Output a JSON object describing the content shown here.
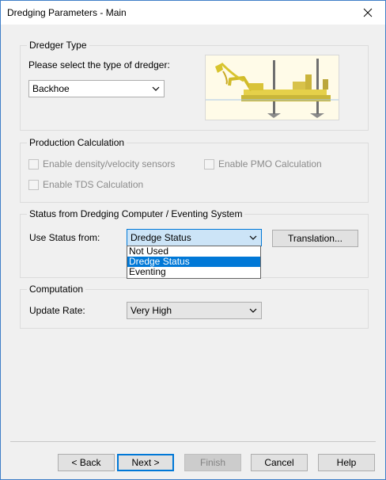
{
  "window": {
    "title": "Dredging Parameters - Main"
  },
  "dredger_type": {
    "group_label": "Dredger Type",
    "prompt": "Please select the type of dredger:",
    "selected": "Backhoe"
  },
  "production": {
    "group_label": "Production Calculation",
    "density_label": "Enable density/velocity sensors",
    "pmo_label": "Enable PMO Calculation",
    "tds_label": "Enable TDS Calculation"
  },
  "status": {
    "group_label": "Status from Dredging Computer / Eventing System",
    "use_label": "Use Status from:",
    "selected": "Dredge Status",
    "translation_button": "Translation...",
    "options": [
      "Not Used",
      "Dredge Status",
      "Eventing"
    ]
  },
  "computation": {
    "group_label": "Computation",
    "rate_label": "Update Rate:",
    "selected": "Very High"
  },
  "footer": {
    "back": "< Back",
    "next": "Next >",
    "finish": "Finish",
    "cancel": "Cancel",
    "help": "Help"
  }
}
